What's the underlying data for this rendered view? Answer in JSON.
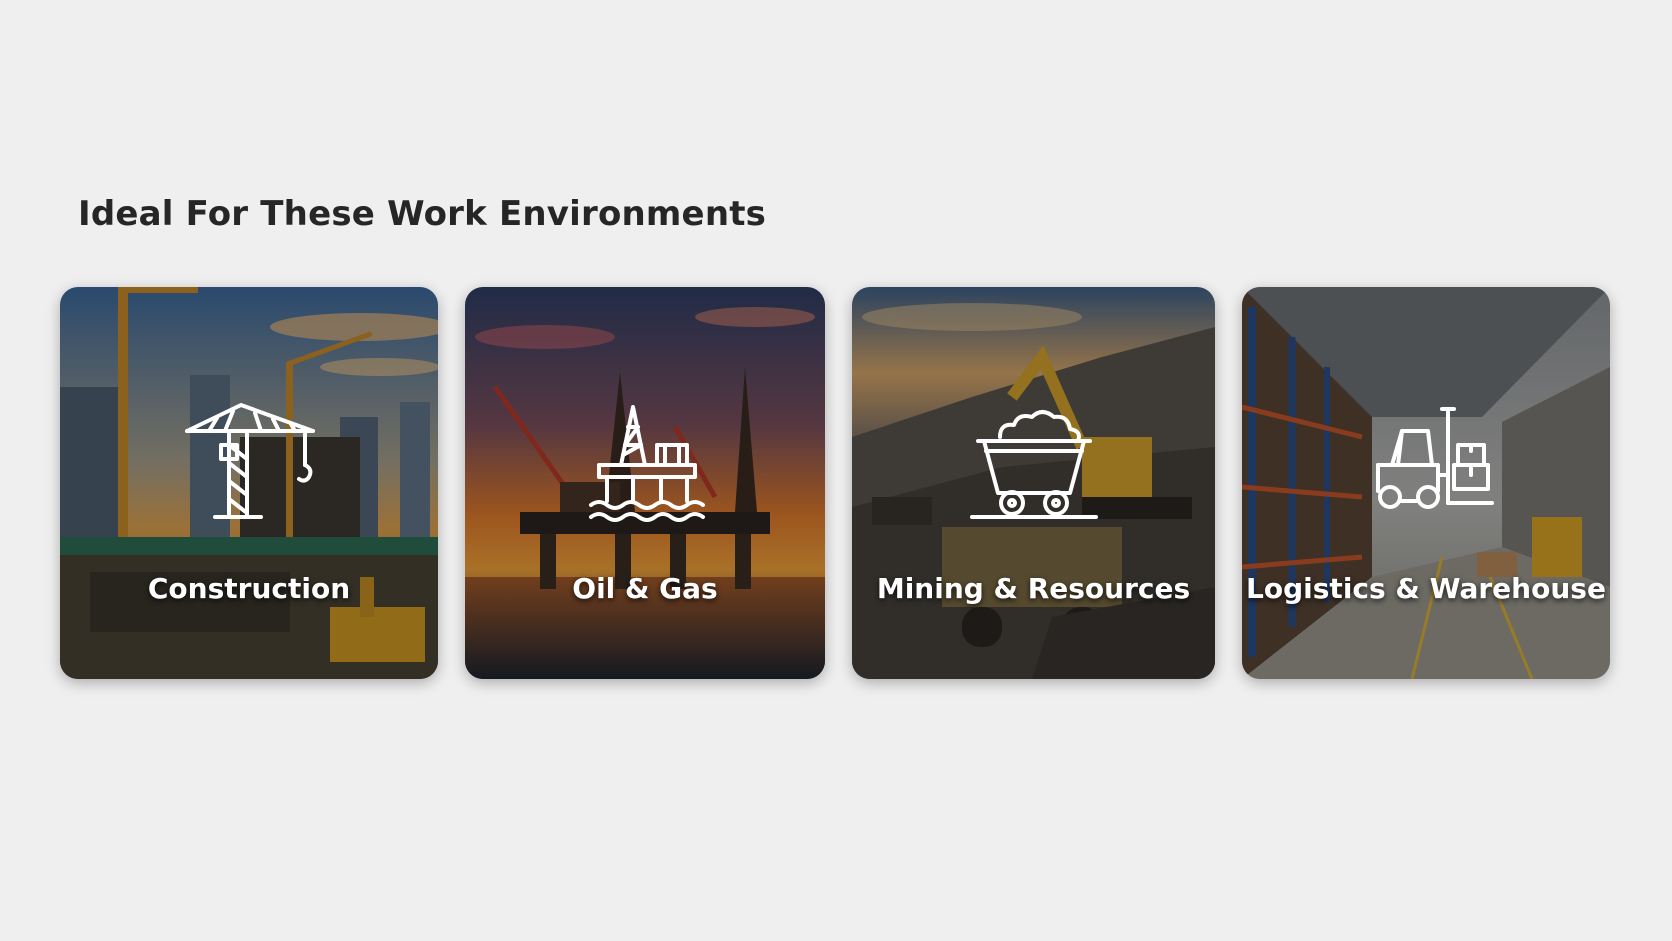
{
  "section": {
    "title": "Ideal For These Work Environments"
  },
  "cards": [
    {
      "label": "Construction",
      "icon": "tower-crane-icon"
    },
    {
      "label": "Oil & Gas",
      "icon": "oil-rig-icon"
    },
    {
      "label": "Mining & Resources",
      "icon": "mine-cart-icon"
    },
    {
      "label": "Logistics & Warehouse",
      "icon": "forklift-icon"
    }
  ]
}
